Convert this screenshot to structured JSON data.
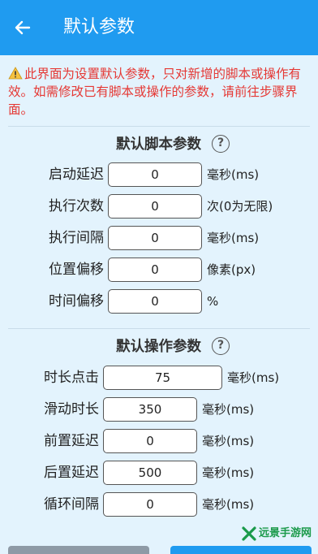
{
  "header": {
    "title": "默认参数"
  },
  "notice": {
    "text": "此界面为设置默认参数，只对新增的脚本或操作有效。如需修改已有脚本或操作的参数，请前往步骤界面。"
  },
  "script_section": {
    "title": "默认脚本参数",
    "fields": [
      {
        "label": "启动延迟",
        "value": "0",
        "unit": "毫秒(ms)"
      },
      {
        "label": "执行次数",
        "value": "0",
        "unit": "次(0为无限)"
      },
      {
        "label": "执行间隔",
        "value": "0",
        "unit": "毫秒(ms)"
      },
      {
        "label": "位置偏移",
        "value": "0",
        "unit": "像素(px)"
      },
      {
        "label": "时间偏移",
        "value": "0",
        "unit": "%"
      }
    ]
  },
  "action_section": {
    "title": "默认操作参数",
    "fields": [
      {
        "label": "时长点击",
        "value": "75",
        "unit": "毫秒(ms)"
      },
      {
        "label": "滑动时长",
        "value": "350",
        "unit": "毫秒(ms)"
      },
      {
        "label": "前置延迟",
        "value": "0",
        "unit": "毫秒(ms)"
      },
      {
        "label": "后置延迟",
        "value": "500",
        "unit": "毫秒(ms)"
      },
      {
        "label": "循环间隔",
        "value": "0",
        "unit": "毫秒(ms)"
      }
    ]
  },
  "watermark": {
    "text": "远景手游网"
  },
  "colors": {
    "appbar": "#1f9bf0",
    "background": "#e3f3fd",
    "warning_text": "#e53935"
  }
}
